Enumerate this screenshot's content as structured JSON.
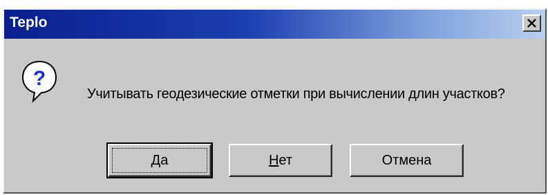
{
  "dialog": {
    "title": "Teplo",
    "close_glyph": "x",
    "message": "Учитывать геодезические отметки при вычислении длин участков?",
    "icon": "question-icon"
  },
  "buttons": {
    "yes": {
      "mnemonic": "Д",
      "rest": "а",
      "default": true
    },
    "no": {
      "mnemonic": "Н",
      "rest": "ет"
    },
    "cancel": {
      "label": "Отмена"
    }
  },
  "colors": {
    "titlebar_start": "#0a1f8e",
    "titlebar_end": "#b9d0ef",
    "face": "#c9c9c9",
    "icon_bubble": "#ffffff",
    "icon_glyph": "#1a2fc0"
  }
}
